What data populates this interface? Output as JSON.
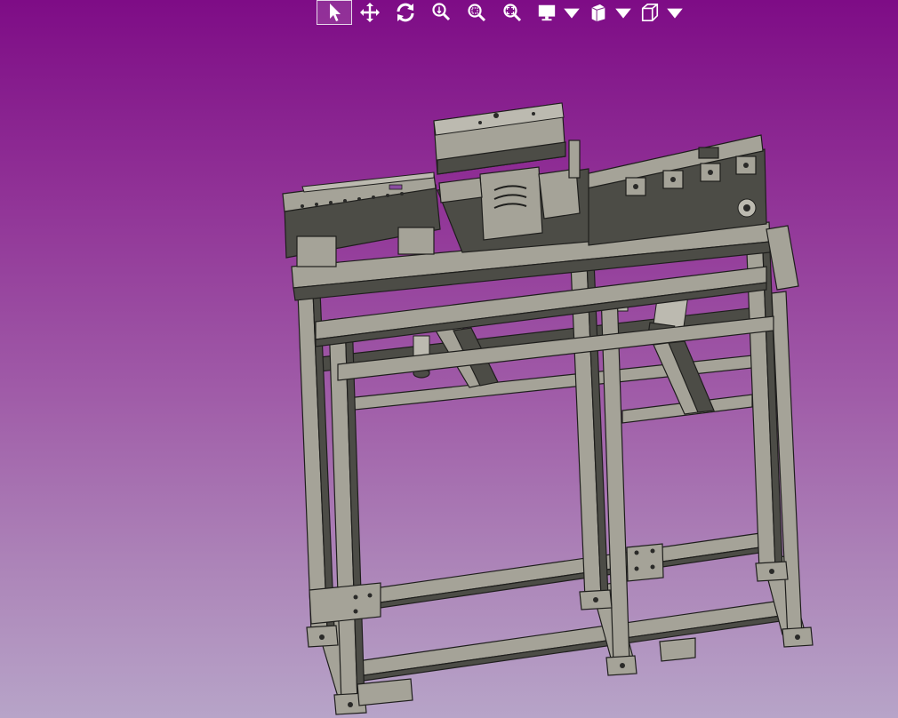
{
  "toolbar": {
    "buttons": [
      {
        "id": "select",
        "icon": "cursor-arrow-icon",
        "active": true
      },
      {
        "id": "pan",
        "icon": "pan-move-icon",
        "active": false
      },
      {
        "id": "rotate",
        "icon": "rotate-icon",
        "active": false
      },
      {
        "id": "zoom",
        "icon": "zoom-icon",
        "active": false
      },
      {
        "id": "zoom-window",
        "icon": "zoom-window-icon",
        "active": false
      },
      {
        "id": "zoom-fit",
        "icon": "zoom-fit-icon",
        "active": false
      },
      {
        "id": "display-mode",
        "icon": "monitor-icon",
        "dropdown": true
      },
      {
        "id": "render-mode",
        "icon": "shading-icon",
        "dropdown": true
      },
      {
        "id": "standard-views",
        "icon": "cube-view-icon",
        "dropdown": true
      }
    ]
  },
  "colors": {
    "accent_icon": "#ffffff",
    "metal_light": "#a4a297",
    "metal_dark": "#4b4b45",
    "edge": "#1e1e1c"
  }
}
